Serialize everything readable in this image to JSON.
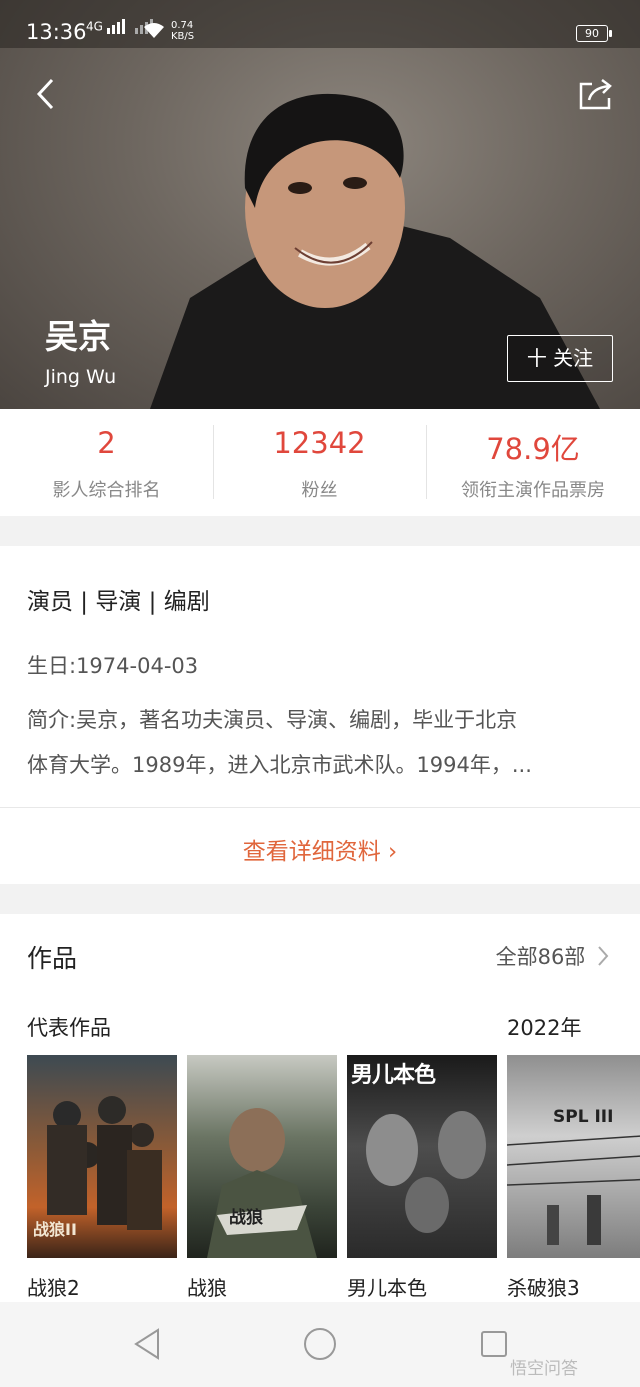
{
  "status_bar": {
    "time": "13:36",
    "signal": "4G",
    "speed_value": "0.74",
    "speed_unit": "KB/S",
    "battery": "90"
  },
  "header": {
    "back_icon": "chevron-left-icon",
    "share_icon": "share-icon"
  },
  "profile": {
    "name_zh": "吴京",
    "name_en": "Jing Wu",
    "follow_label": "十 关注"
  },
  "stats": [
    {
      "value": "2",
      "label": "影人综合排名"
    },
    {
      "value": "12342",
      "label": "粉丝"
    },
    {
      "value": "78.9亿",
      "label": "领衔主演作品票房"
    }
  ],
  "info": {
    "roles": "演员 | 导演 | 编剧",
    "birthday": "生日:1974-04-03",
    "bio_line1": "简介:吴京，著名功夫演员、导演、编剧，毕业于北京",
    "bio_line2": "体育大学。1989年，进入北京市武术队。1994年，...",
    "detail_link": "查看详细资料 ›"
  },
  "works": {
    "title": "作品",
    "all_link": "全部86部",
    "representative_label": "代表作品",
    "year_label": "2022年",
    "items": [
      {
        "title": "战狼2",
        "poster_text": "战狼II"
      },
      {
        "title": "战狼",
        "poster_text": "战狼"
      },
      {
        "title": "男儿本色",
        "poster_text": "男儿本色"
      },
      {
        "title": "杀破狼3",
        "poster_text": "SPL III"
      }
    ]
  },
  "nav": {
    "back_icon": "triangle-back-icon",
    "home_icon": "circle-home-icon",
    "recent_icon": "square-recent-icon"
  },
  "watermark": "悟空问答",
  "colors": {
    "accent_red": "#e0473c",
    "link_orange": "#e0663c"
  }
}
